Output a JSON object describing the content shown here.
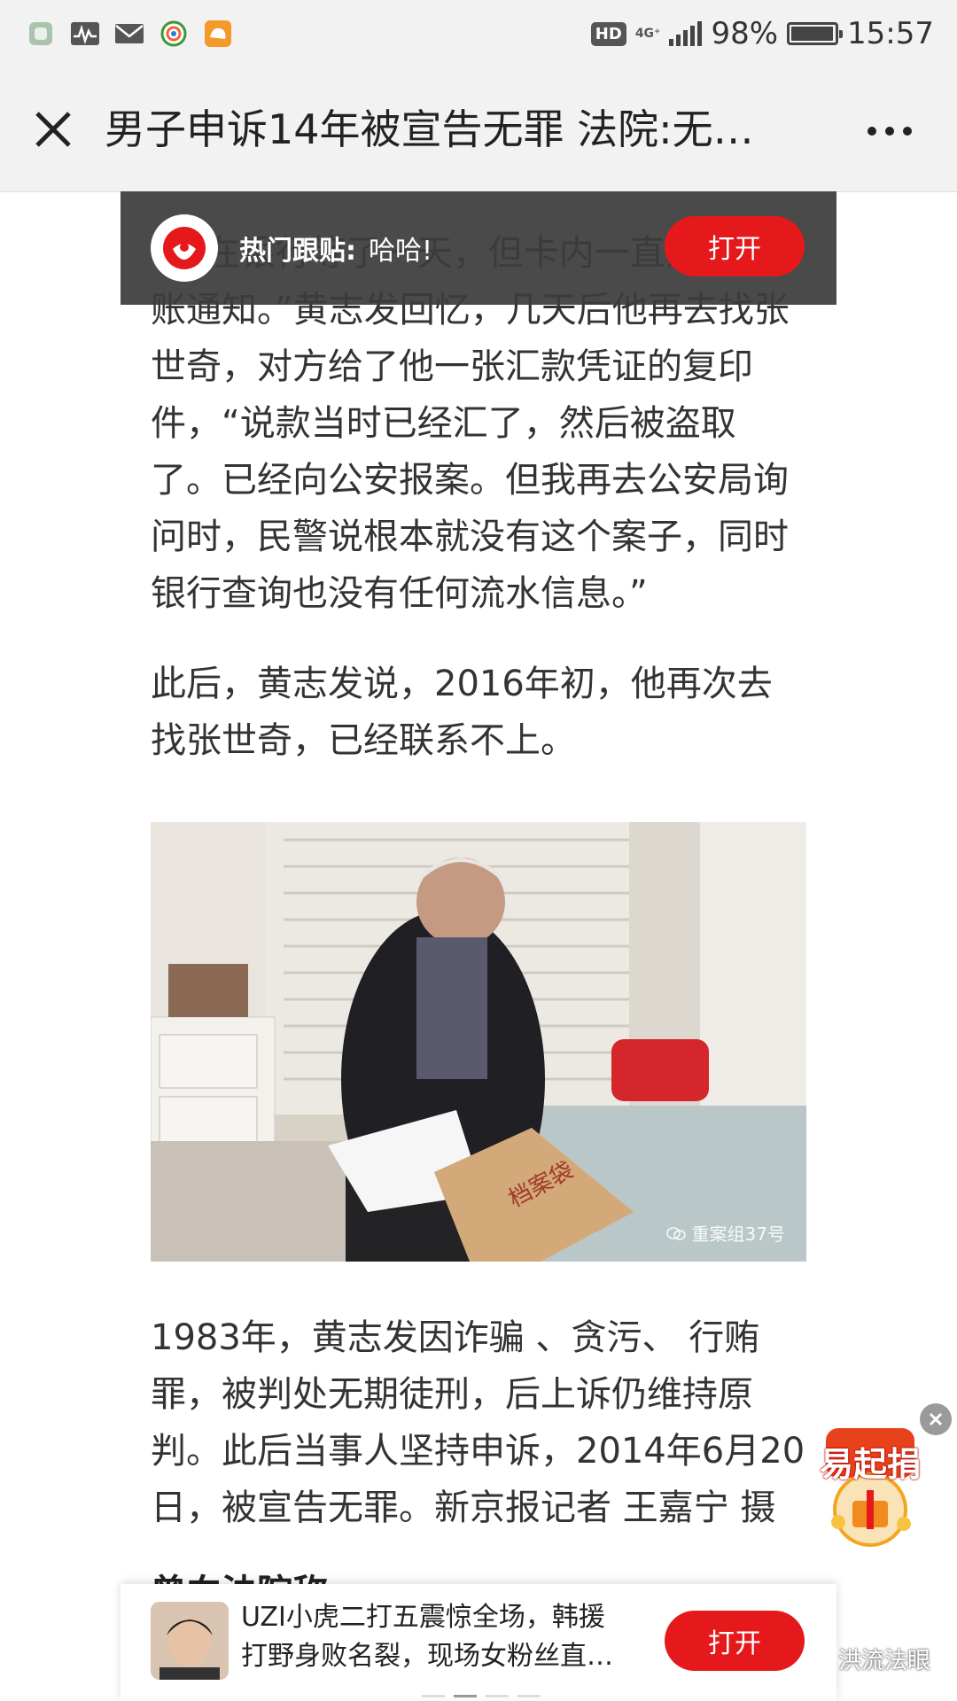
{
  "status_bar": {
    "hd": "HD",
    "network": "4G⁺",
    "battery": "98%",
    "battery_level": 0.98,
    "time": "15:57",
    "icons": [
      "app-icon",
      "activity-icon",
      "mail-icon",
      "browser-icon",
      "uc-browser-icon"
    ]
  },
  "header": {
    "title": "男子申诉14年被宣告无罪 法院:无…",
    "close_icon": "close-icon",
    "more_icon": "more-icon"
  },
  "hot_banner": {
    "label": "热门跟贴:",
    "text": "哈哈!",
    "open_label": "打开"
  },
  "article": {
    "para1": "“我在银行等了一天，但卡内一直没有到账通知。”黄志发回忆，几天后他再去找张世奇，对方给了他一张汇款凭证的复印件，“说款当时已经汇了，然后被盗取了。已经向公安报案。但我再去公安局询问时，民警说根本就没有这个案子，同时银行查询也没有任何流水信息。”",
    "para2": "此后，黄志发说，2016年初，他再次去找张世奇，已经联系不上。",
    "photo_watermark": "重案组37号",
    "para3": "1983年，黄志发因诈骗 、贪污、 行贿罪，被判处无期徒刑，后上诉仍维持原判。此后当事人坚持申诉，2014年6月20日，被宣告无罪。新京报记者 王嘉宁 摄",
    "para4": "曾向法院称"
  },
  "donate_badge": {
    "text": "易起捐"
  },
  "ad": {
    "line1": "UZI小虎二打五震惊全场，韩援",
    "line2": "打野身败名裂，现场女粉丝直…",
    "open_label": "打开"
  },
  "corner_mark": "洪流法眼",
  "colors": {
    "accent_red": "#e5191c",
    "banner_bg": "#3c3c3c",
    "bar_bg": "#f2f2f2"
  }
}
